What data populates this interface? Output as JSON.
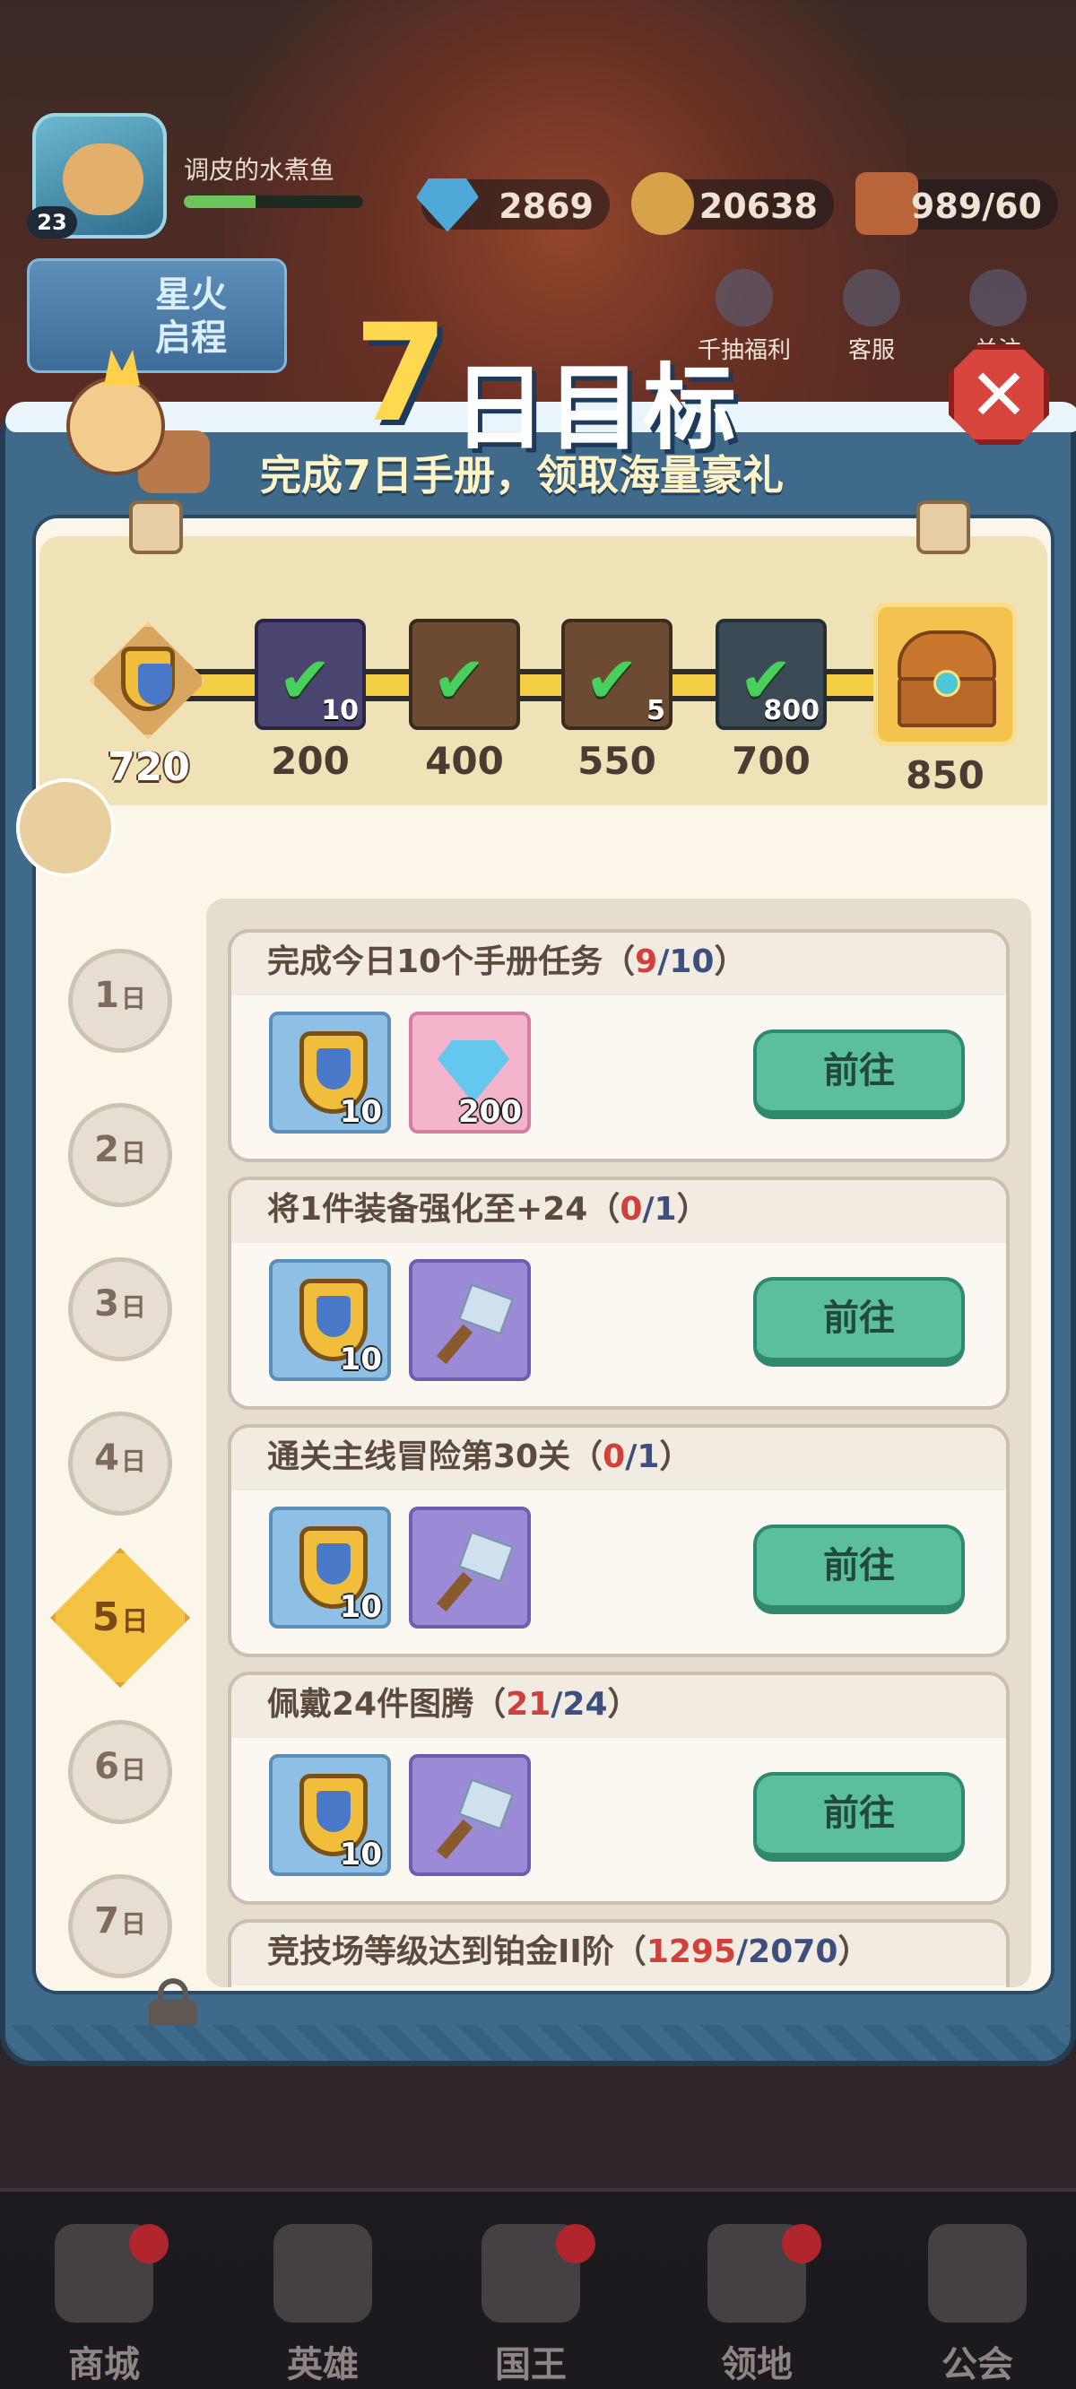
{
  "player": {
    "name": "调皮的水煮鱼",
    "level": "23",
    "exp_fraction": 0.4
  },
  "resources": {
    "diamonds": "2869",
    "coins": "20638",
    "stamina": "989/60"
  },
  "header_buttons": {
    "spark_event": "星火\n启程",
    "free_draw": "千抽福利",
    "service": "客服",
    "follow": "关注"
  },
  "popup": {
    "title_number": "7",
    "title_text": "日目标",
    "subtitle": "完成7日手册，领取海量豪礼",
    "close_symbol": "✕"
  },
  "progress": {
    "current_score": "720",
    "fill_fraction": 0.98,
    "milestones": [
      {
        "label": "200",
        "qty": "10",
        "claimed": true,
        "item": "manual-book"
      },
      {
        "label": "400",
        "qty": "",
        "claimed": true,
        "item": "avatar-frame"
      },
      {
        "label": "550",
        "qty": "5",
        "claimed": true,
        "item": "hammer"
      },
      {
        "label": "700",
        "qty": "800",
        "claimed": true,
        "item": "diamond"
      }
    ],
    "chest": {
      "label": "850",
      "item": "treasure-chest"
    }
  },
  "days": [
    {
      "label": "1",
      "suffix": "日"
    },
    {
      "label": "2",
      "suffix": "日"
    },
    {
      "label": "3",
      "suffix": "日"
    },
    {
      "label": "4",
      "suffix": "日"
    },
    {
      "label": "5",
      "suffix": "日",
      "active": true
    },
    {
      "label": "6",
      "suffix": "日"
    },
    {
      "label": "7",
      "suffix": "日",
      "locked": true
    }
  ],
  "tasks": [
    {
      "title": "完成今日10个手册任务",
      "done": "9",
      "total": "10",
      "rewards": [
        {
          "type": "shield",
          "qty": "10"
        },
        {
          "type": "gem",
          "qty": "200"
        }
      ],
      "button": "前往"
    },
    {
      "title": "将1件装备强化至+24",
      "done": "0",
      "total": "1",
      "rewards": [
        {
          "type": "shield",
          "qty": "10"
        },
        {
          "type": "hammer",
          "qty": ""
        }
      ],
      "button": "前往"
    },
    {
      "title": "通关主线冒险第30关",
      "done": "0",
      "total": "1",
      "rewards": [
        {
          "type": "shield",
          "qty": "10"
        },
        {
          "type": "hammer",
          "qty": ""
        }
      ],
      "button": "前往"
    },
    {
      "title": "佩戴24件图腾",
      "done": "21",
      "total": "24",
      "rewards": [
        {
          "type": "shield",
          "qty": "10"
        },
        {
          "type": "hammer",
          "qty": ""
        }
      ],
      "button": "前往"
    },
    {
      "title": "竞技场等级达到铂金II阶",
      "done": "1295",
      "total": "2070",
      "rewards": [],
      "button": ""
    }
  ],
  "bottom_nav": [
    {
      "label": "商城",
      "badge": true
    },
    {
      "label": "英雄",
      "badge": false
    },
    {
      "label": "国王",
      "badge": true
    },
    {
      "label": "领地",
      "badge": true
    },
    {
      "label": "公会",
      "badge": false
    }
  ],
  "colors": {
    "progress_done": "#d1403b",
    "progress_total": "#3c4f7d",
    "go_button": "#5bbf9d",
    "active_day": "#f5c343",
    "track_fill": "#f4cf45"
  }
}
